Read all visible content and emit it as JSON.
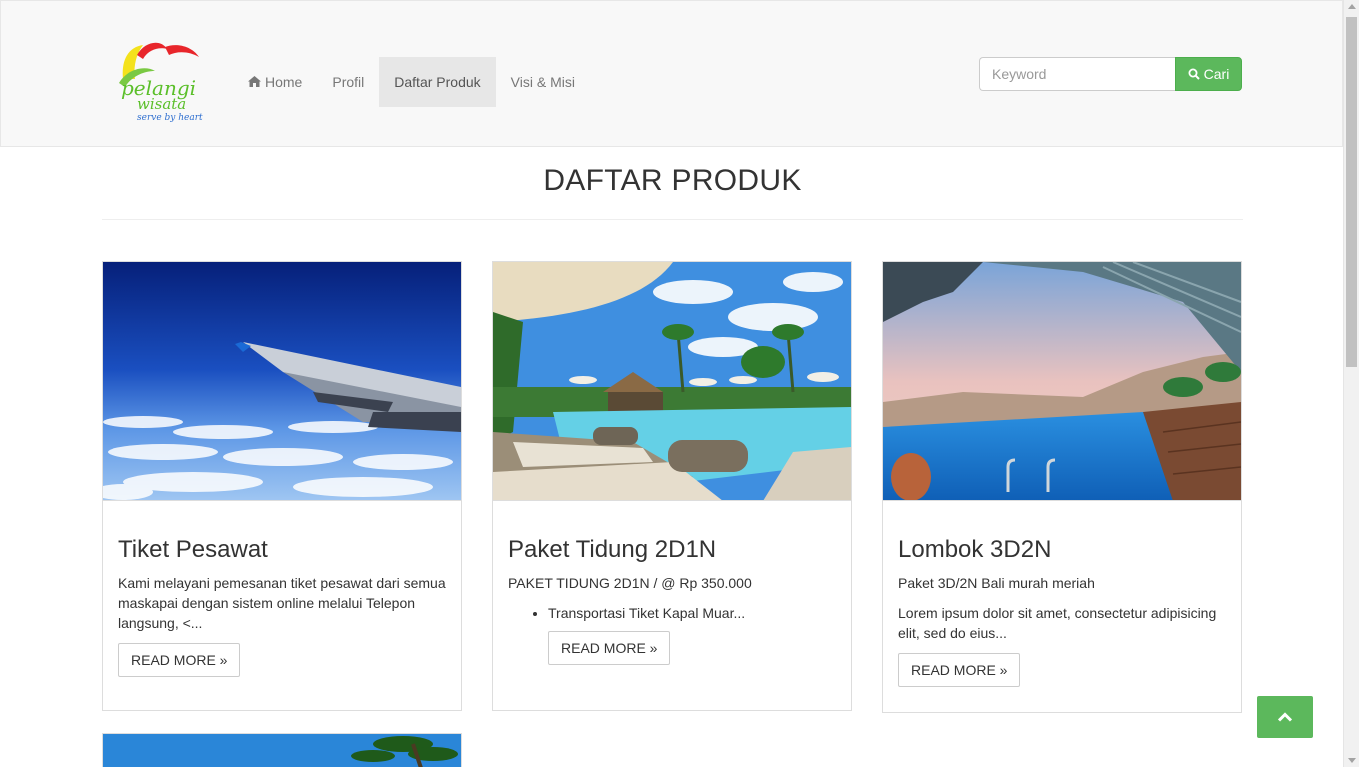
{
  "brand": {
    "logo_text": "pelangi wisata",
    "tagline": "serve by heart"
  },
  "nav": {
    "items": [
      {
        "label": "Home",
        "icon": "home-icon"
      },
      {
        "label": "Profil"
      },
      {
        "label": "Daftar Produk",
        "active": true
      },
      {
        "label": "Visi & Misi"
      }
    ]
  },
  "search": {
    "placeholder": "Keyword",
    "button_label": "Cari",
    "button_color": "#5cb85c"
  },
  "page": {
    "title": "DAFTAR PRODUK"
  },
  "products": [
    {
      "title": "Tiket Pesawat",
      "excerpt": "Kami melayani pemesanan tiket pesawat dari semua maskapai dengan sistem online melalui Telepon langsung, <...",
      "read_more": "READ MORE »"
    },
    {
      "title": "Paket Tidung 2D1N",
      "excerpt": "PAKET TIDUNG 2D1N / @ Rp 350.000",
      "bullet": "Transportasi Tiket Kapal Muar...",
      "read_more": "READ MORE »"
    },
    {
      "title": "Lombok 3D2N",
      "excerpt": "Paket 3D/2N Bali murah meriah",
      "excerpt2": "Lorem ipsum dolor sit amet, consectetur adipisicing elit, sed do eius...",
      "read_more": "READ MORE »"
    }
  ]
}
